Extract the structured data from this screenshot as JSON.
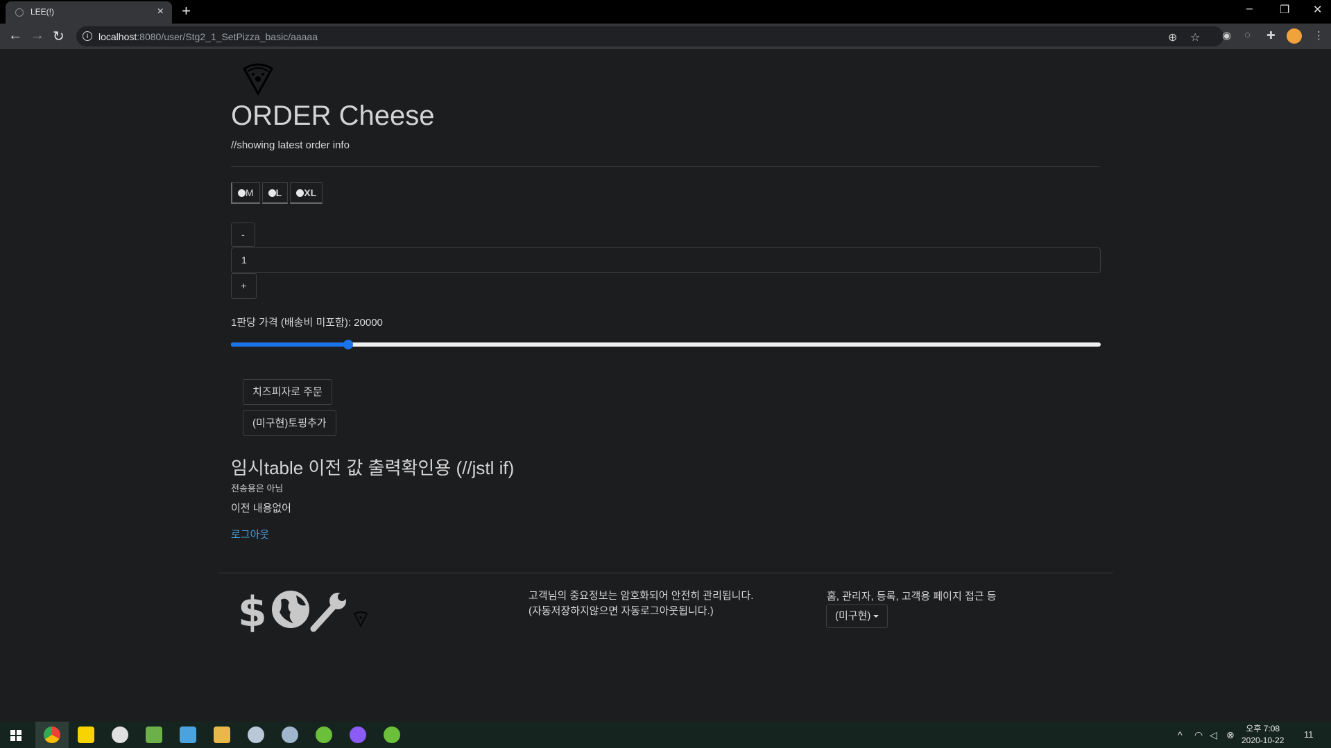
{
  "browser": {
    "tab_title": "LEE(!)",
    "tab_close": "×",
    "new_tab": "+",
    "url_host": "localhost",
    "url_rest": ":8080/user/Stg2_1_SetPizza_basic/aaaaa",
    "window_controls": [
      "–",
      "❐",
      "✕"
    ]
  },
  "page": {
    "title": "ORDER Cheese",
    "subtitle": "//showing latest order info",
    "sizes": [
      "M",
      "L",
      "XL"
    ],
    "minus_label": "-",
    "quantity": "1",
    "plus_label": "+",
    "price_text": "1판당 가격 (배송비 미포함): 20000",
    "slider_fraction": 0.135,
    "order_button": "치즈피자로 주문",
    "topping_button": "(미구현)토핑추가",
    "temp_heading": "임시table 이전 값 출력확인용 (//jstl if)",
    "not_for_send": "전송용은 아님",
    "no_previous": "이전 내용없어",
    "logout": "로그아웃"
  },
  "footer": {
    "security_line1": "고객님의 중요정보는 암호화되어 안전히 관리됩니다.",
    "security_line2": "(자동저장하지않으면 자동로그아웃됩니다.)",
    "nav_text": "홈, 관리자, 등록, 고객용 페이지 접근 등",
    "dropdown_label": "(미구현)",
    "icons": [
      "dollar-icon",
      "globe-icon",
      "wrench-icon",
      "pizza-icon"
    ]
  },
  "taskbar": {
    "time": "오후 7:08",
    "date": "2020-10-22",
    "notification_count": "11"
  },
  "colors": {
    "background": "#1c1d1f",
    "slider_accent": "#1a73e8",
    "link": "#4a9fd9"
  }
}
